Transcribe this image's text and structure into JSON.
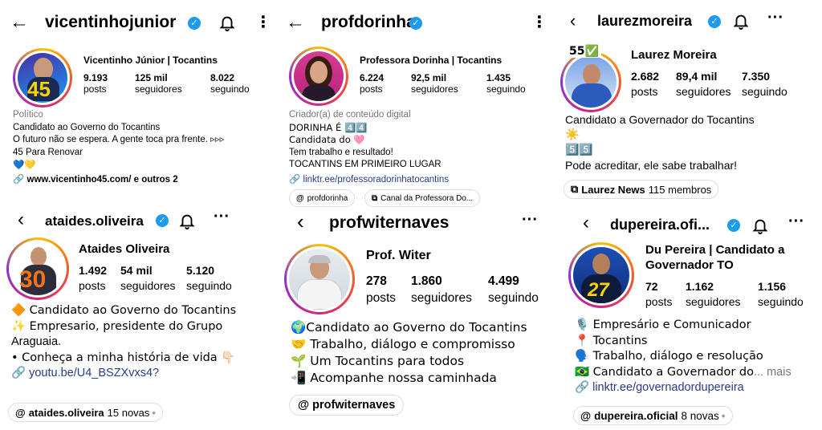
{
  "panels": {
    "vicentinho": {
      "username": "vicentinhojunior",
      "display_name": "Vicentinho Júnior | Tocantins",
      "avatar_number": "45",
      "stats": [
        {
          "n": "9.193",
          "l": "posts"
        },
        {
          "n": "125 mil",
          "l": "seguidores"
        },
        {
          "n": "8.022",
          "l": "seguindo"
        }
      ],
      "category": "Político",
      "bio": [
        "Candidato ao Governo do Tocantins",
        "O futuro não se espera. A gente toca pra frente. ▹▹▹",
        "45 Para Renovar",
        "💙💛"
      ],
      "link": "www.vicentinho45.com/ e outros 2"
    },
    "dorinha": {
      "username": "profdorinha",
      "display_name": "Professora Dorinha | Tocantins",
      "stats": [
        {
          "n": "6.224",
          "l": "posts"
        },
        {
          "n": "92,5 mil",
          "l": "seguidores"
        },
        {
          "n": "1.435",
          "l": "seguindo"
        }
      ],
      "category": "Criador(a) de conteúdo digital",
      "bio": [
        "DORINHA É 4️⃣4️⃣",
        "Candidata do 🩷",
        "Tem trabalho e resultado!",
        "TOCANTINS EM PRIMEIRO LUGAR"
      ],
      "link": "linktr.ee/professoradorinhatocantins",
      "chips": [
        "profdorinha",
        "Canal da Professora Do..."
      ]
    },
    "laurez": {
      "username": "laurezmoreira",
      "display_name": "Laurez Moreira",
      "note": "55✅",
      "stats": [
        {
          "n": "2.682",
          "l": "posts"
        },
        {
          "n": "89,4 mil",
          "l": "seguidores"
        },
        {
          "n": "7.350",
          "l": "seguindo"
        }
      ],
      "bio": [
        "Candidato a Governador do Tocantins",
        "☀️",
        "5️⃣5️⃣",
        "Pode acreditar, ele sabe trabalhar!"
      ],
      "channel_name": "Laurez News",
      "channel_members": "115 membros"
    },
    "ataides": {
      "username": "ataides.oliveira",
      "display_name": "Ataides Oliveira",
      "avatar_number": "30",
      "stats": [
        {
          "n": "1.492",
          "l": "posts"
        },
        {
          "n": "54 mil",
          "l": "seguidores"
        },
        {
          "n": "5.120",
          "l": "seguindo"
        }
      ],
      "bio": [
        "🔶 Candidato ao Governo do Tocantins",
        "✨ Empresario, presidente do Grupo",
        "Araguaia.",
        "• Conheça a minha história de vida 👇🏻"
      ],
      "link": "youtu.be/U4_BSZXvxs4?",
      "threads_name": "ataides.oliveira",
      "threads_count": "15 novas"
    },
    "witer": {
      "username": "profwiternaves",
      "display_name": "Prof. Witer",
      "stats": [
        {
          "n": "278",
          "l": "posts"
        },
        {
          "n": "1.860",
          "l": "seguidores"
        },
        {
          "n": "4.499",
          "l": "seguindo"
        }
      ],
      "bio": [
        "🌍Candidato ao Governo do Tocantins",
        "🤝 Trabalho, diálogo e compromisso",
        "🌱 Um Tocantins para todos",
        "📲 Acompanhe nossa caminhada"
      ],
      "threads_name": "profwiternaves"
    },
    "dupereira": {
      "username": "dupereira.ofi...",
      "display_name_1": "Du Pereira | Candidato a",
      "display_name_2": "Governador TO",
      "avatar_number": "27",
      "stats": [
        {
          "n": "72",
          "l": "posts"
        },
        {
          "n": "1.162",
          "l": "seguidores"
        },
        {
          "n": "1.156",
          "l": "seguindo"
        }
      ],
      "bio": [
        "🎙️ Empresário e Comunicador",
        "📍 Tocantins",
        "🗣️ Trabalho, diálogo e resolução",
        "🇧🇷 Candidato a Governador do"
      ],
      "more": "... mais",
      "link": "linktr.ee/governadordupereira",
      "threads_name": "dupereira.oficial",
      "threads_count": "8 novas"
    }
  },
  "colors": {
    "verified": "#1d9bf0",
    "link": "#2a3a8a",
    "gray": "#777777"
  },
  "icons": [
    "back-arrow-icon",
    "chevron-left-icon",
    "verified-badge-icon",
    "bell-icon",
    "more-dots-icon",
    "link-icon",
    "threads-icon",
    "channel-icon"
  ]
}
